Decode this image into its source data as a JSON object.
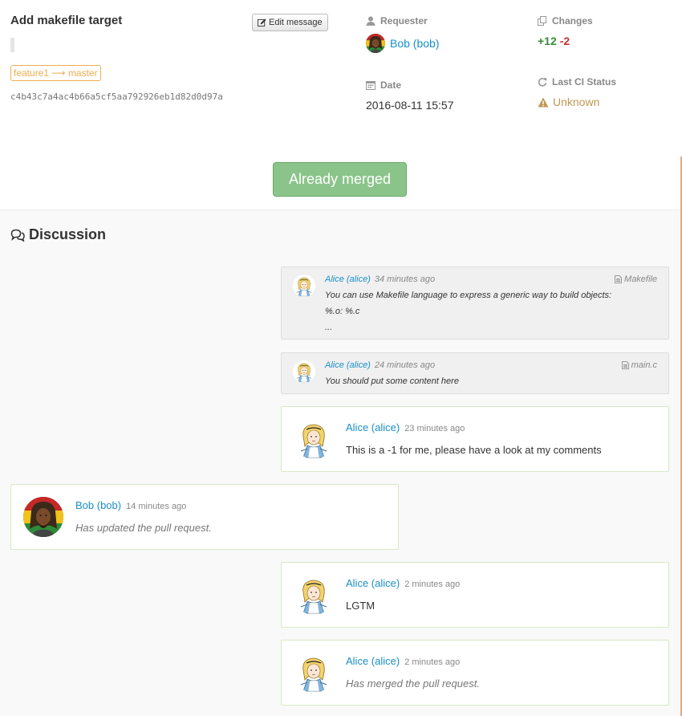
{
  "pr": {
    "title": "Add makefile target",
    "edit_label": "Edit message",
    "branch_from": "feature1",
    "branch_arrow": "⟶",
    "branch_to": "master",
    "commit": "c4b43c7a4ac4b66a5cf5aa792926eb1d82d0d97a"
  },
  "meta": {
    "requester_label": "Requester",
    "requester": "Bob (bob)",
    "date_label": "Date",
    "date": "2016-08-11 15:57",
    "changes_label": "Changes",
    "added": "+12",
    "removed": "-2",
    "ci_label": "Last CI Status",
    "ci_status": "Unknown"
  },
  "merge_button": "Already merged",
  "discussion": {
    "title": "Discussion",
    "inline_comments": [
      {
        "author": "Alice (alice)",
        "time": "34 minutes ago",
        "file": "Makefile",
        "lines": [
          "You can use Makefile language to express a generic way to build objects:",
          "%.o: %.c",
          "..."
        ]
      },
      {
        "author": "Alice (alice)",
        "time": "24 minutes ago",
        "file": "main.c",
        "lines": [
          "You should put some content here"
        ]
      }
    ],
    "comments": [
      {
        "author": "Alice (alice)",
        "time": "23 minutes ago",
        "body": "This is a -1 for me, please have a look at my comments"
      },
      {
        "author": "Bob (bob)",
        "time": "14 minutes ago",
        "body": "Has updated the pull request."
      },
      {
        "author": "Alice (alice)",
        "time": "2 minutes ago",
        "body": "LGTM"
      },
      {
        "author": "Alice (alice)",
        "time": "2 minutes ago",
        "body": "Has merged the pull request."
      }
    ]
  },
  "colors": {
    "link": "#1a8fc9",
    "added": "#3c8a3c",
    "removed": "#c9302c",
    "warning": "#c09853",
    "merged_button": "#8ac48a"
  }
}
